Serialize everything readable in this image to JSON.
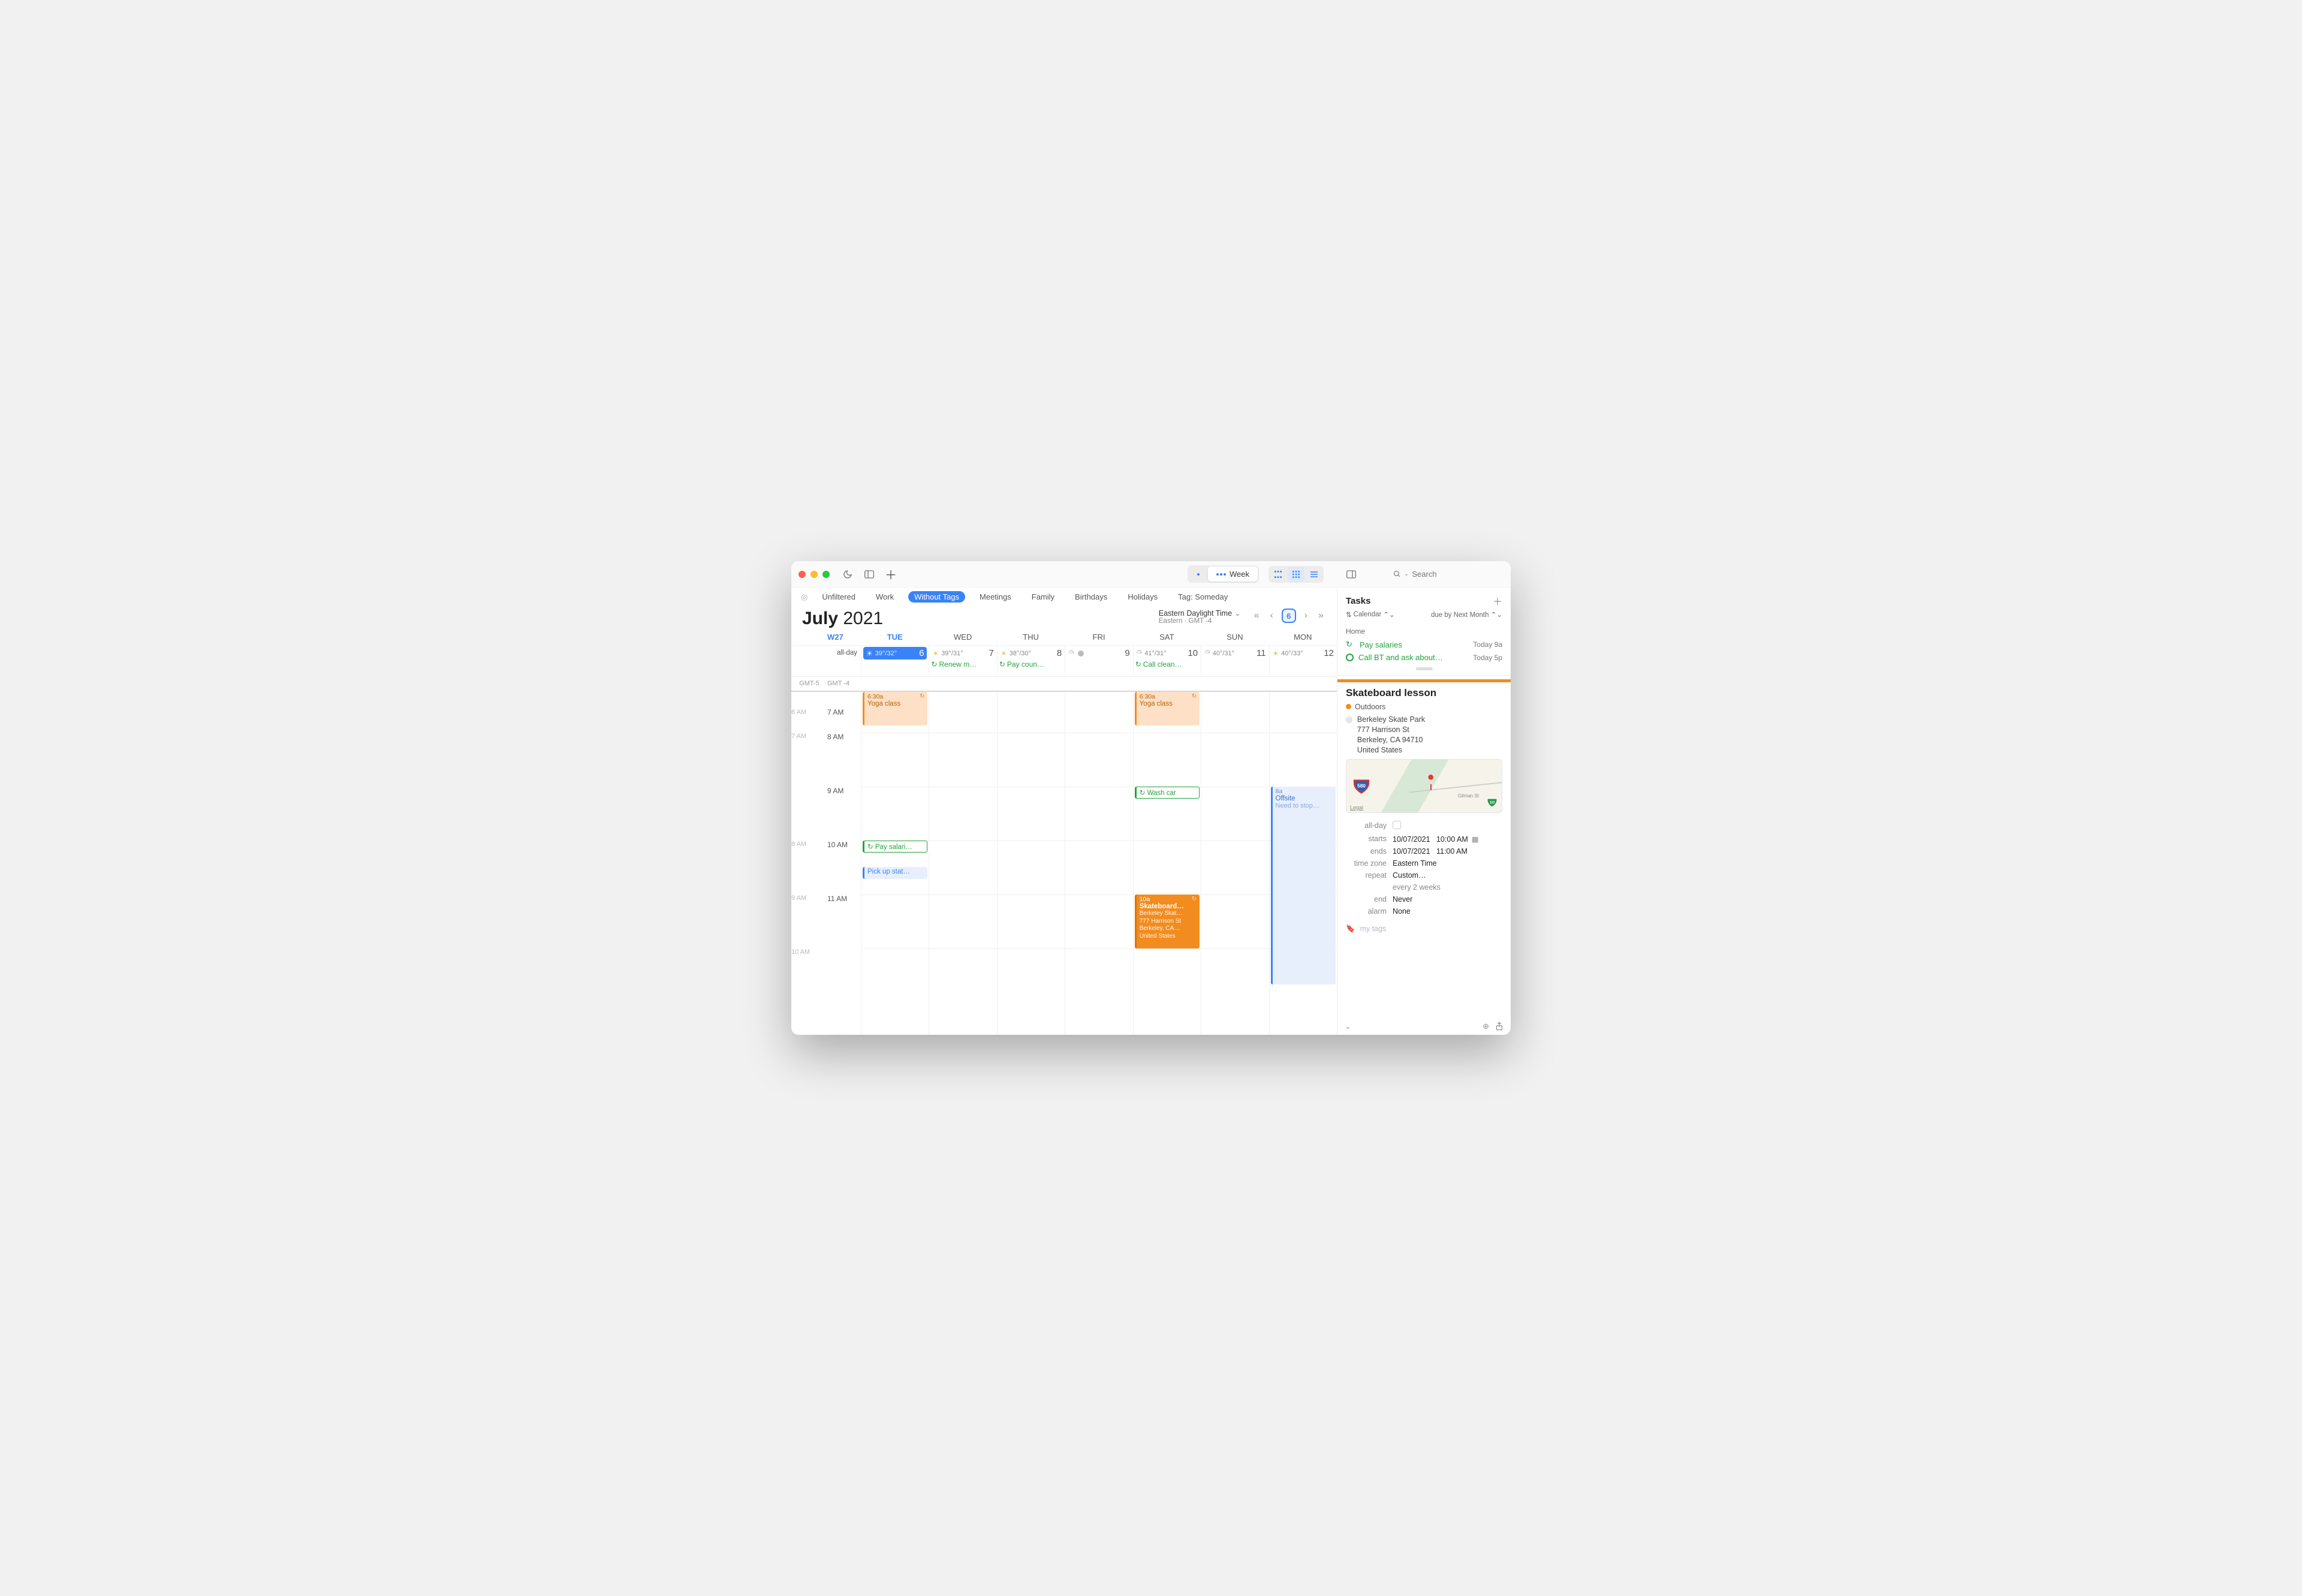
{
  "toolbar": {
    "week_label": "Week"
  },
  "search": {
    "placeholder": "Search"
  },
  "filters": {
    "items": [
      "Unfiltered",
      "Work",
      "Without Tags",
      "Meetings",
      "Family",
      "Birthdays",
      "Holidays",
      "Tag: Someday"
    ],
    "active_index": 2
  },
  "title": {
    "month": "July",
    "year": "2021"
  },
  "timezone": {
    "name": "Eastern Daylight Time",
    "sub": "Eastern · GMT -4",
    "alt": "GMT-5",
    "main": "GMT -4"
  },
  "nav": {
    "today_num": "6"
  },
  "week_label": "W27",
  "days": [
    {
      "dow": "TUE",
      "num": "6",
      "temps": "39°/32°",
      "today": true,
      "tasks": []
    },
    {
      "dow": "WED",
      "num": "7",
      "temps": "39°/31°",
      "tasks": [
        "Renew m…"
      ]
    },
    {
      "dow": "THU",
      "num": "8",
      "temps": "38°/30°",
      "tasks": [
        "Pay coun…"
      ]
    },
    {
      "dow": "FRI",
      "num": "9",
      "temps": "",
      "tasks": []
    },
    {
      "dow": "SAT",
      "num": "10",
      "temps": "41°/31°",
      "tasks": [
        "Call clean…"
      ]
    },
    {
      "dow": "SUN",
      "num": "11",
      "temps": "40°/31°",
      "tasks": []
    },
    {
      "dow": "MON",
      "num": "12",
      "temps": "40°/33°",
      "tasks": []
    }
  ],
  "allday_label": "all-day",
  "hours_alt": [
    "6 AM",
    "7 AM",
    "",
    "8 AM",
    "9 AM",
    "10 AM"
  ],
  "hours": [
    "7 AM",
    "8 AM",
    "9 AM",
    "10 AM",
    "11 AM"
  ],
  "events": {
    "tue_yoga": {
      "time": "6:30a",
      "title": "Yoga class"
    },
    "tue_pay": {
      "title": "Pay salari…"
    },
    "tue_pickup": {
      "title": "Pick up stat…"
    },
    "sat_yoga": {
      "time": "6:30a",
      "title": "Yoga class"
    },
    "sat_wash": {
      "title": "Wash car"
    },
    "sat_skate": {
      "time": "10a",
      "title": "Skateboard…",
      "l1": "Berkeley Skat…",
      "l2": "777 Harrison St",
      "l3": "Berkeley, CA…",
      "l4": "United States"
    },
    "mon_offsite": {
      "time": "8a",
      "title": "Offsite",
      "note": "Need to stop…"
    }
  },
  "tasks": {
    "header": "Tasks",
    "sort_left": "Calendar",
    "sort_right": "due by Next Month",
    "group": "Home",
    "items": [
      {
        "title": "Pay salaries",
        "due": "Today 9a",
        "repeat": true
      },
      {
        "title": "Call BT and ask about…",
        "due": "Today 5p",
        "repeat": false
      }
    ]
  },
  "detail": {
    "title": "Skateboard lesson",
    "calendar": "Outdoors",
    "location_name": "Berkeley Skate Park",
    "addr1": "777 Harrison St",
    "addr2": "Berkeley, CA  94710",
    "addr3": "United States",
    "map_legal": "Legal",
    "map_road": "Gilman St",
    "fields": {
      "allday_label": "all-day",
      "starts_label": "starts",
      "starts_date": "10/07/2021",
      "starts_time": "10:00 AM",
      "ends_label": "ends",
      "ends_date": "10/07/2021",
      "ends_time": "11:00 AM",
      "tz_label": "time zone",
      "tz_val": "Eastern Time",
      "repeat_label": "repeat",
      "repeat_val": "Custom…",
      "repeat_sub": "every 2 weeks",
      "end_label": "end",
      "end_val": "Never",
      "alarm_label": "alarm",
      "alarm_val": "None"
    },
    "tags_placeholder": "my tags"
  }
}
